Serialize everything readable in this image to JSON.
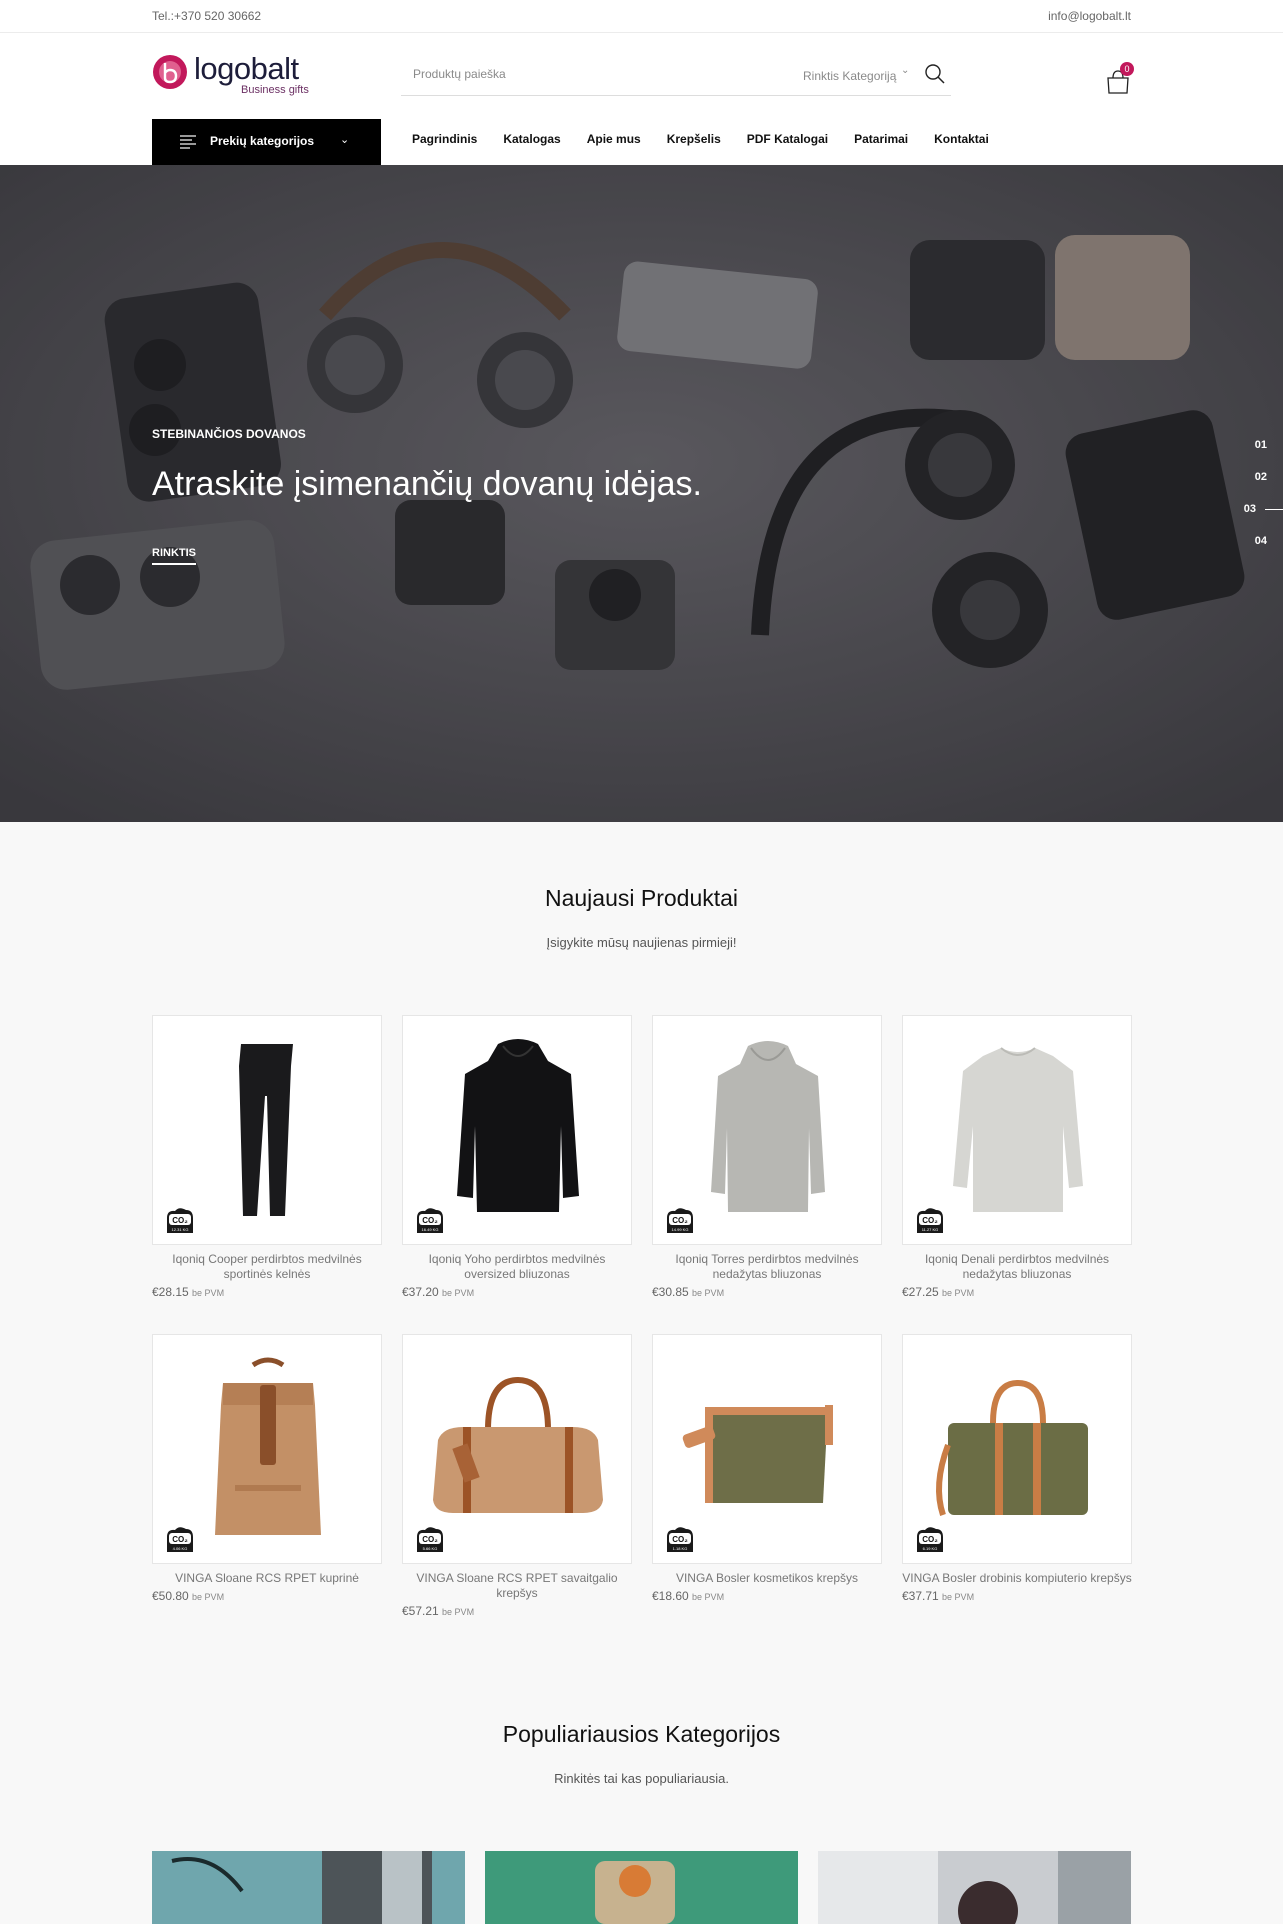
{
  "topbar": {
    "phone": "Tel.:+370 520 30662",
    "email": "info@logobalt.lt"
  },
  "brand": {
    "name": "logobalt",
    "tagline": "Business gifts",
    "accent": "#c2185b"
  },
  "search": {
    "placeholder": "Produktų paieška",
    "category_label": "Rinktis Kategoriją"
  },
  "cart": {
    "count": "0"
  },
  "categories_button": {
    "label": "Prekių kategorijos"
  },
  "nav": [
    "Pagrindinis",
    "Katalogas",
    "Apie mus",
    "Krepšelis",
    "PDF Katalogai",
    "Patarimai",
    "Kontaktai"
  ],
  "hero": {
    "eyebrow": "STEBINANČIOS DOVANOS",
    "heading": "Atraskite įsimenančių dovanų idėjas.",
    "cta": "RINKTIS",
    "slides": [
      "01",
      "02",
      "03",
      "04"
    ],
    "active_slide": "03"
  },
  "new_products": {
    "title": "Naujausi Produktai",
    "subtitle": "Įsigykite mūsų naujienas pirmieji!",
    "items": [
      {
        "name": "Iqoniq Cooper perdirbtos medvilnės sportinės kelnės",
        "price": "€28.15",
        "vat": "be PVM",
        "co2": "12.31 KG",
        "icon": "pants"
      },
      {
        "name": "Iqoniq Yoho perdirbtos medvilnės oversized bliuzonas",
        "price": "€37.20",
        "vat": "be PVM",
        "co2": "16.49 KG",
        "icon": "hoodie-black"
      },
      {
        "name": "Iqoniq Torres perdirbtos medvilnės nedažytas bliuzonas",
        "price": "€30.85",
        "vat": "be PVM",
        "co2": "14.99 KG",
        "icon": "hoodie-grey"
      },
      {
        "name": "Iqoniq Denali perdirbtos medvilnės nedažytas bliuzonas",
        "price": "€27.25",
        "vat": "be PVM",
        "co2": "11.27 KG",
        "icon": "sweater"
      },
      {
        "name": "VINGA Sloane RCS RPET kuprinė",
        "price": "€50.80",
        "vat": "be PVM",
        "co2": "4.06 KG",
        "icon": "backpack"
      },
      {
        "name": "VINGA Sloane RCS RPET savaitgalio krepšys",
        "price": "€57.21",
        "vat": "be PVM",
        "co2": "5.66 KG",
        "icon": "duffel"
      },
      {
        "name": "VINGA Bosler kosmetikos krepšys",
        "price": "€18.60",
        "vat": "be PVM",
        "co2": "1.18 KG",
        "icon": "pouch"
      },
      {
        "name": "VINGA Bosler drobinis kompiuterio krepšys",
        "price": "€37.71",
        "vat": "be PVM",
        "co2": "6.19 KG",
        "icon": "laptop-bag"
      }
    ]
  },
  "popular_categories": {
    "title": "Populiariausios Kategorijos",
    "subtitle": "Rinkitės tai kas populiariausia."
  }
}
